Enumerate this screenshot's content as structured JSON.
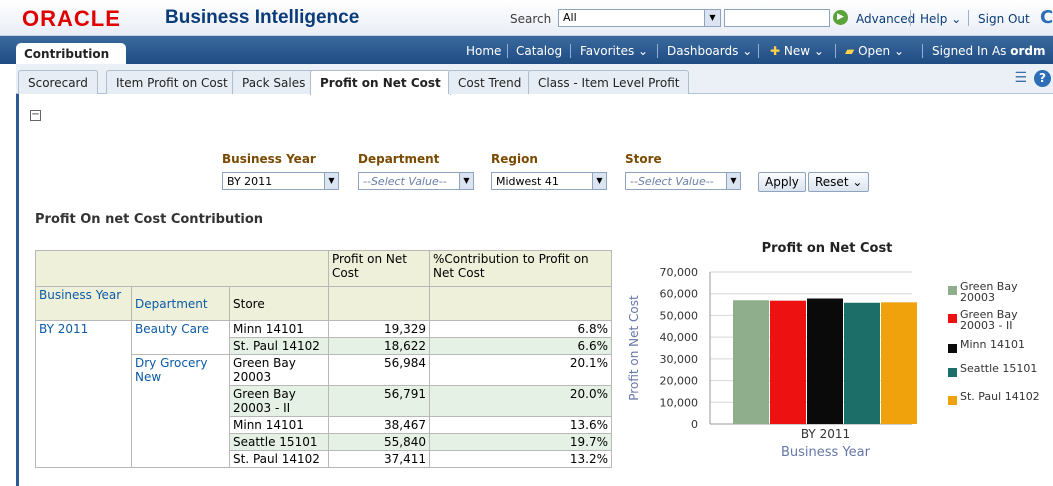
{
  "header": {
    "logo": "ORACLE",
    "product": "Business Intelligence",
    "search_label": "Search",
    "search_scope": "All",
    "advanced": "Advanced",
    "help": "Help",
    "sign_out": "Sign Out"
  },
  "nav": {
    "dashboard_tab": "Contribution",
    "home": "Home",
    "catalog": "Catalog",
    "favorites": "Favorites",
    "dashboards": "Dashboards",
    "new": "New",
    "open": "Open",
    "signed_in_as": "Signed In As",
    "user": "ordm"
  },
  "tabs": [
    "Scorecard",
    "Item Profit on Cost",
    "Pack Sales",
    "Profit on Net Cost",
    "Cost Trend",
    "Class - Item Level Profit"
  ],
  "active_tab": "Profit on Net Cost",
  "prompts": {
    "business_year": {
      "label": "Business Year",
      "value": "BY 2011"
    },
    "department": {
      "label": "Department",
      "value": "--Select Value--"
    },
    "region": {
      "label": "Region",
      "value": "Midwest 41"
    },
    "store": {
      "label": "Store",
      "value": "--Select Value--"
    },
    "apply": "Apply",
    "reset": "Reset"
  },
  "section_title": "Profit On net Cost Contribution",
  "table": {
    "measure_headers": [
      "Profit on Net Cost",
      "%Contribution to Profit on Net Cost"
    ],
    "dim_headers": [
      "Business Year",
      "Department",
      "Store"
    ],
    "business_year": "BY 2011",
    "departments": [
      "Beauty Care",
      "Dry Grocery New"
    ],
    "rows": [
      {
        "store": "Minn 14101",
        "profit": "19,329",
        "pct": "6.8%"
      },
      {
        "store": "St. Paul 14102",
        "profit": "18,622",
        "pct": "6.6%"
      },
      {
        "store": "Green Bay 20003",
        "profit": "56,984",
        "pct": "20.1%"
      },
      {
        "store": "Green Bay 20003 - II",
        "profit": "56,791",
        "pct": "20.0%"
      },
      {
        "store": "Minn 14101",
        "profit": "38,467",
        "pct": "13.6%"
      },
      {
        "store": "Seattle 15101",
        "profit": "55,840",
        "pct": "19.7%"
      },
      {
        "store": "St. Paul 14102",
        "profit": "37,411",
        "pct": "13.2%"
      }
    ]
  },
  "chart_data": {
    "type": "bar",
    "title": "Profit on Net Cost",
    "xlabel": "Business Year",
    "ylabel": "Profit on Net Cost",
    "categories": [
      "BY 2011"
    ],
    "ylim": [
      0,
      70000
    ],
    "yticks": [
      "0",
      "10,000",
      "20,000",
      "30,000",
      "40,000",
      "50,000",
      "60,000",
      "70,000"
    ],
    "grid": true,
    "legend_position": "right",
    "series": [
      {
        "name": "Green Bay 20003",
        "values": [
          56984
        ],
        "color": "#8fae8c"
      },
      {
        "name": "Green Bay 20003 - II",
        "values": [
          56791
        ],
        "color": "#ee1111"
      },
      {
        "name": "Minn 14101",
        "values": [
          57796
        ],
        "color": "#0a0a0a"
      },
      {
        "name": "Seattle 15101",
        "values": [
          55840
        ],
        "color": "#1c6e68"
      },
      {
        "name": "St. Paul 14102",
        "values": [
          56033
        ],
        "color": "#f0a20c"
      }
    ]
  }
}
